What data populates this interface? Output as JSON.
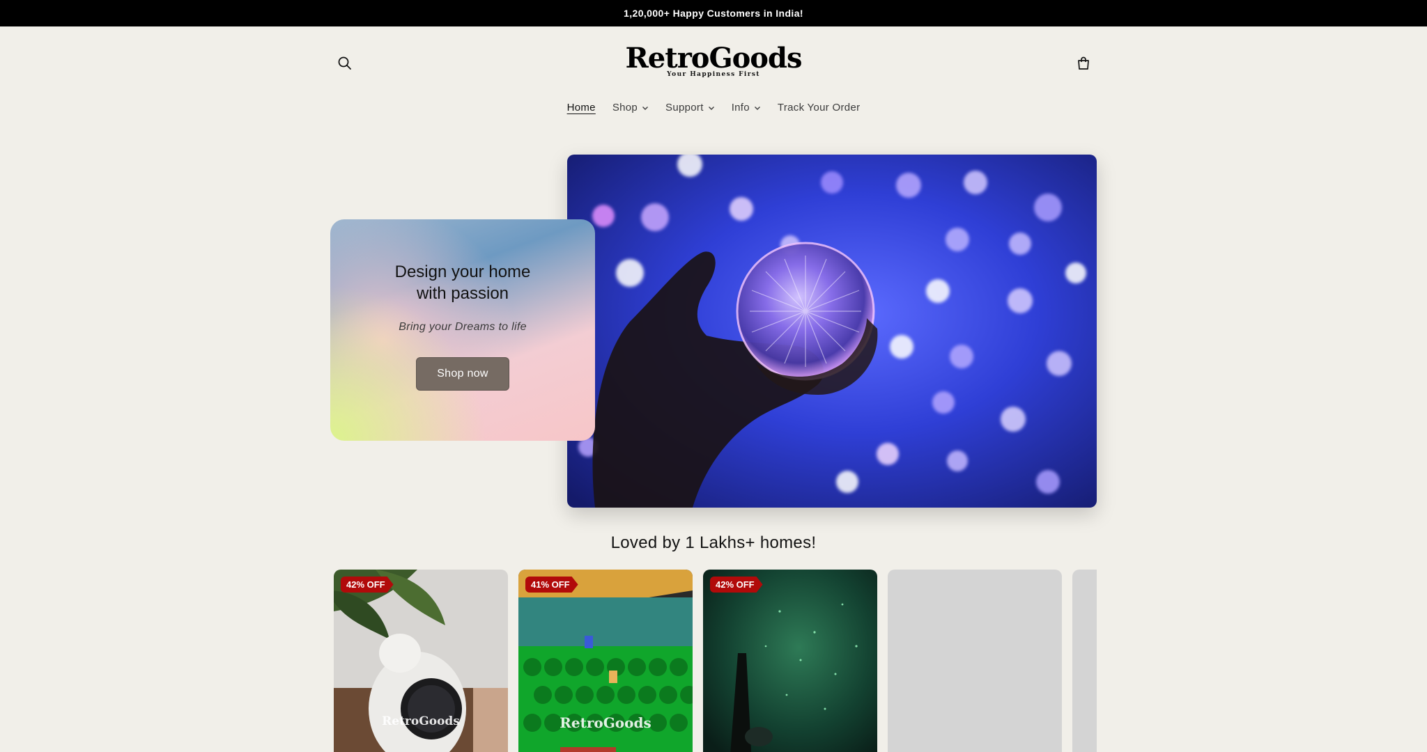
{
  "announcement": "1,20,000+ Happy Customers in India!",
  "header": {
    "logo_text": "RetroGoods",
    "logo_tagline": "Your Happiness First",
    "search_icon": "search-icon",
    "cart_icon": "cart-icon"
  },
  "nav": {
    "items": [
      {
        "label": "Home",
        "active": true,
        "dropdown": false
      },
      {
        "label": "Shop",
        "active": false,
        "dropdown": true
      },
      {
        "label": "Support",
        "active": false,
        "dropdown": true
      },
      {
        "label": "Info",
        "active": false,
        "dropdown": true
      },
      {
        "label": "Track Your Order",
        "active": false,
        "dropdown": false
      }
    ]
  },
  "hero": {
    "title_line1": "Design your home",
    "title_line2": "with passion",
    "subtitle": "Bring your Dreams to life",
    "button": "Shop now"
  },
  "products": {
    "title": "Loved by 1 Lakhs+ homes!",
    "cards": [
      {
        "badge": "42% OFF",
        "watermark": "RetroGoods"
      },
      {
        "badge": "41% OFF",
        "watermark": "RetroGoods"
      },
      {
        "badge": "42% OFF",
        "watermark": ""
      }
    ]
  },
  "colors": {
    "announcement_bg": "#000000",
    "page_bg": "#f1efe9",
    "badge": "#b10a0a",
    "button": "#766b63"
  }
}
